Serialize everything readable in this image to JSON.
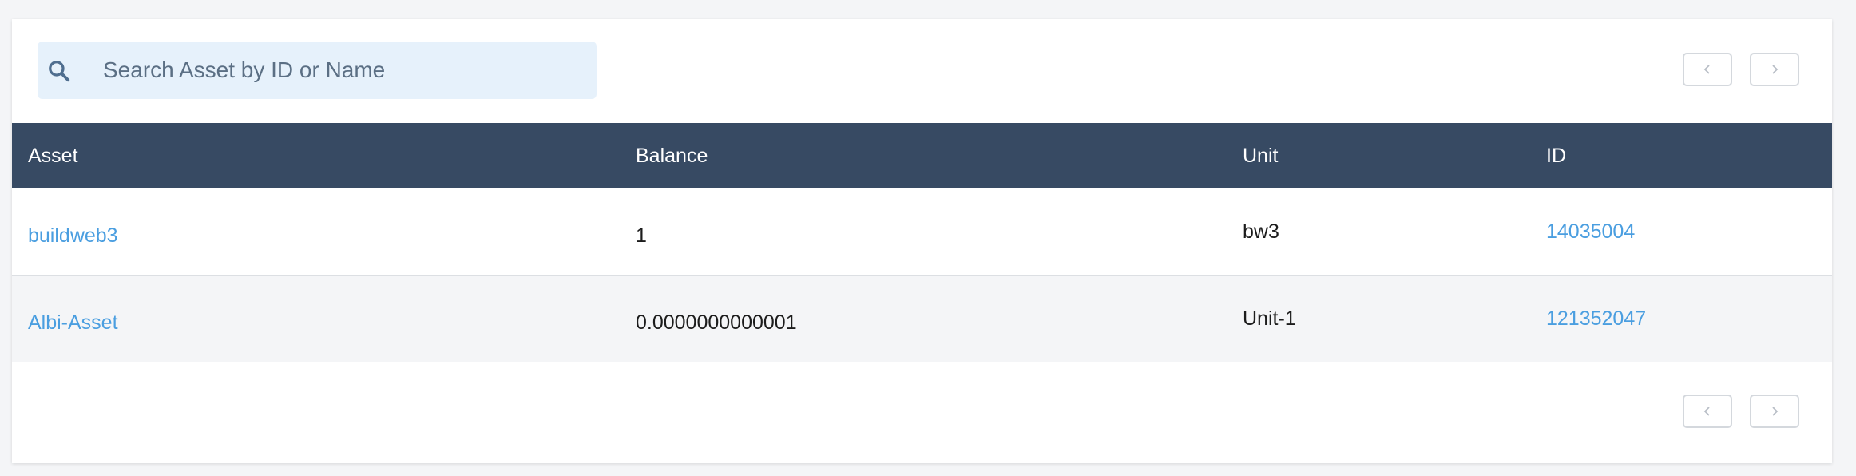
{
  "search": {
    "placeholder": "Search Asset by ID or Name",
    "value": ""
  },
  "pagination": {
    "prev_icon": "chevron-left-icon",
    "next_icon": "chevron-right-icon"
  },
  "table": {
    "headers": {
      "asset": "Asset",
      "balance": "Balance",
      "unit": "Unit",
      "id": "ID"
    },
    "rows": [
      {
        "asset": "buildweb3",
        "balance": "1",
        "unit": "bw3",
        "id": "14035004"
      },
      {
        "asset": "Albi-Asset",
        "balance": "0.0000000000001",
        "unit": "Unit-1",
        "id": "121352047"
      }
    ]
  },
  "colors": {
    "header_bg": "#374a63",
    "link": "#4a9ee0",
    "search_bg": "#e6f1fb"
  }
}
